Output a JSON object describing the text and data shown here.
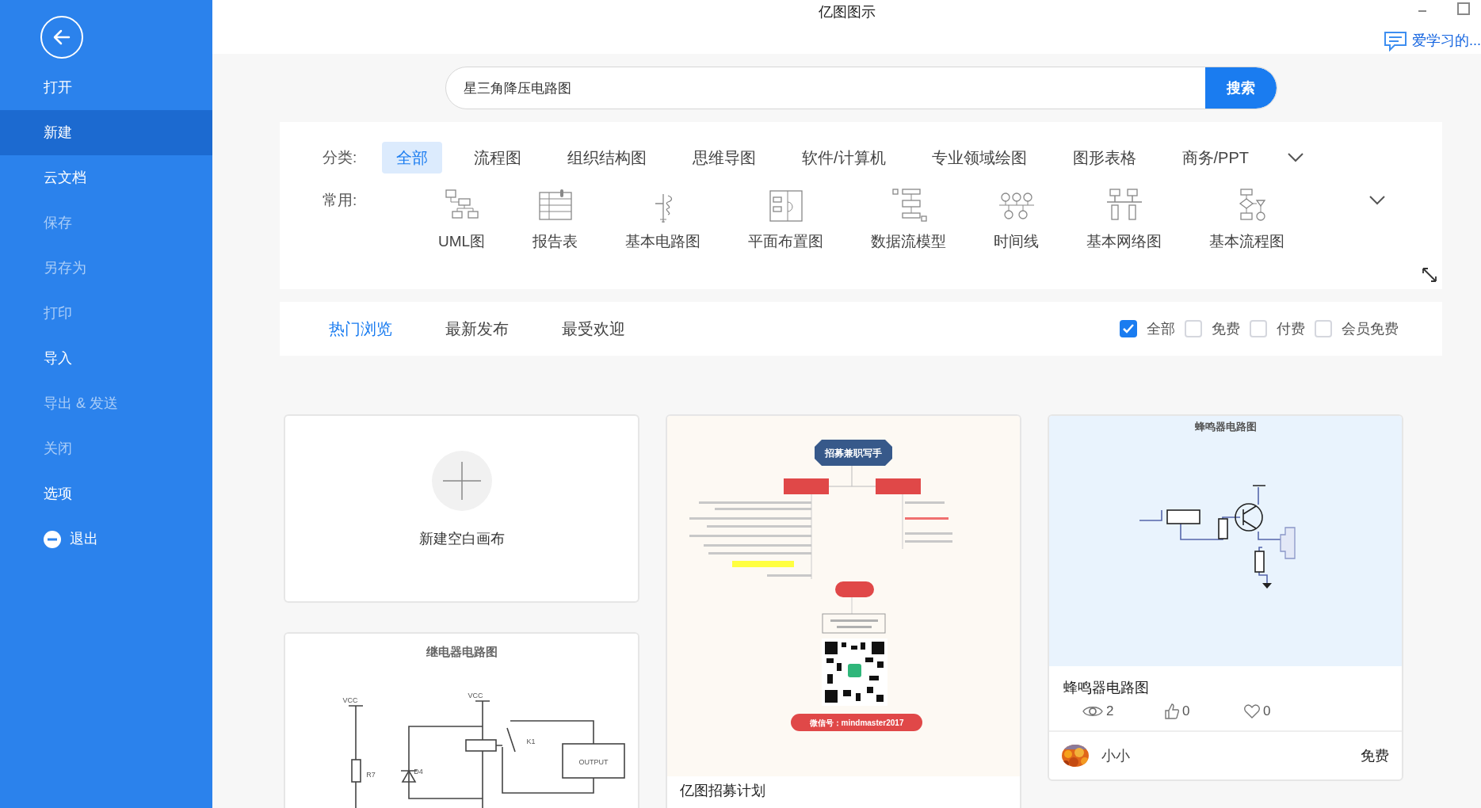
{
  "window": {
    "title": "亿图图示"
  },
  "account": {
    "name": "爱学习的..."
  },
  "sidebar": {
    "items": [
      {
        "label": "打开",
        "selected": false,
        "disabled": false,
        "kind": "plain"
      },
      {
        "label": "新建",
        "selected": true,
        "disabled": false,
        "kind": "plain"
      },
      {
        "label": "云文档",
        "selected": false,
        "disabled": false,
        "kind": "plain"
      },
      {
        "label": "保存",
        "selected": false,
        "disabled": true,
        "kind": "plain"
      },
      {
        "label": "另存为",
        "selected": false,
        "disabled": true,
        "kind": "plain"
      },
      {
        "label": "打印",
        "selected": false,
        "disabled": true,
        "kind": "plain"
      },
      {
        "label": "导入",
        "selected": false,
        "disabled": false,
        "kind": "plain"
      },
      {
        "label": "导出 & 发送",
        "selected": false,
        "disabled": true,
        "kind": "plain"
      },
      {
        "label": "关闭",
        "selected": false,
        "disabled": true,
        "kind": "plain"
      },
      {
        "label": "选项",
        "selected": false,
        "disabled": false,
        "kind": "plain"
      },
      {
        "label": "退出",
        "selected": false,
        "disabled": false,
        "kind": "exit"
      }
    ]
  },
  "search": {
    "value": "星三角降压电路图",
    "button": "搜索"
  },
  "categories": {
    "label": "分类:",
    "items": [
      {
        "label": "全部",
        "selected": true
      },
      {
        "label": "流程图",
        "selected": false
      },
      {
        "label": "组织结构图",
        "selected": false
      },
      {
        "label": "思维导图",
        "selected": false
      },
      {
        "label": "软件/计算机",
        "selected": false
      },
      {
        "label": "专业领域绘图",
        "selected": false
      },
      {
        "label": "图形表格",
        "selected": false
      },
      {
        "label": "商务/PPT",
        "selected": false
      }
    ]
  },
  "common": {
    "label": "常用:",
    "items": [
      {
        "label": "UML图"
      },
      {
        "label": "报告表"
      },
      {
        "label": "基本电路图"
      },
      {
        "label": "平面布置图"
      },
      {
        "label": "数据流模型"
      },
      {
        "label": "时间线"
      },
      {
        "label": "基本网络图"
      },
      {
        "label": "基本流程图"
      }
    ]
  },
  "tabs": [
    {
      "label": "热门浏览",
      "selected": true
    },
    {
      "label": "最新发布",
      "selected": false
    },
    {
      "label": "最受欢迎",
      "selected": false
    }
  ],
  "filters": [
    {
      "label": "全部",
      "checked": true
    },
    {
      "label": "免费",
      "checked": false
    },
    {
      "label": "付费",
      "checked": false
    },
    {
      "label": "会员免费",
      "checked": false
    }
  ],
  "columns": [
    [
      {
        "kind": "blank",
        "label": "新建空白画布"
      },
      {
        "kind": "relay",
        "thumb_title": "继电器电路图",
        "thumb_labels": [
          "VCC",
          "VCC",
          "R7",
          "D4",
          "K1",
          "OUTPUT"
        ]
      }
    ],
    [
      {
        "kind": "mindmap",
        "thumb_title": "招募兼职写手",
        "thumb_caption": "微信号：mindmaster2017",
        "title": "亿图招募计划"
      }
    ],
    [
      {
        "kind": "buzzer",
        "thumb_title": "蜂鸣器电路图",
        "title": "蜂鸣器电路图",
        "views": "2",
        "likes": "0",
        "favorites": "0",
        "author": "小小",
        "price": "免费"
      }
    ]
  ]
}
